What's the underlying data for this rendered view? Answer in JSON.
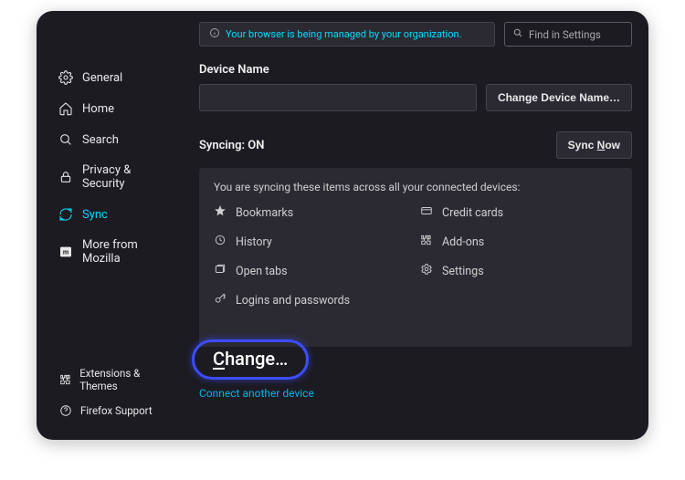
{
  "topbar": {
    "org_message": "Your browser is being managed by your organization.",
    "search_placeholder": "Find in Settings"
  },
  "sidebar": {
    "items": [
      {
        "label": "General"
      },
      {
        "label": "Home"
      },
      {
        "label": "Search"
      },
      {
        "label": "Privacy & Security"
      },
      {
        "label": "Sync"
      },
      {
        "label": "More from Mozilla"
      }
    ],
    "footer": [
      {
        "label": "Extensions & Themes"
      },
      {
        "label": "Firefox Support"
      }
    ]
  },
  "device": {
    "heading": "Device Name",
    "change_btn": "Change Device Name…"
  },
  "sync": {
    "heading": "Syncing: ON",
    "sync_now": "Sync Now",
    "panel_desc": "You are syncing these items across all your connected devices:",
    "items_left": [
      "Bookmarks",
      "History",
      "Open tabs",
      "Logins and passwords"
    ],
    "items_right": [
      "Credit cards",
      "Add-ons",
      "Settings"
    ],
    "change_label": "Change…"
  },
  "connect": {
    "link": "Connect another device"
  }
}
